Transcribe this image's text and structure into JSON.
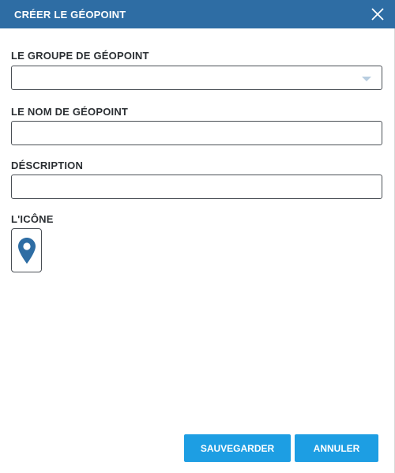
{
  "dialog": {
    "title": "CRÉER LE GÉOPOINT",
    "close_icon": "close-icon"
  },
  "form": {
    "group": {
      "label": "LE GROUPE DE GÉOPOINT",
      "value": ""
    },
    "name": {
      "label": "LE NOM DE GÉOPOINT",
      "value": ""
    },
    "description": {
      "label": "DÉSCRIPTION",
      "value": ""
    },
    "icon": {
      "label": "L'ICÔNE",
      "selected_icon": "map-pin-icon"
    }
  },
  "actions": {
    "save_label": "SAUVEGARDER",
    "cancel_label": "ANNULER"
  },
  "colors": {
    "header": "#2e6da4",
    "button": "#1d9ee3",
    "pin": "#2e6da4"
  }
}
